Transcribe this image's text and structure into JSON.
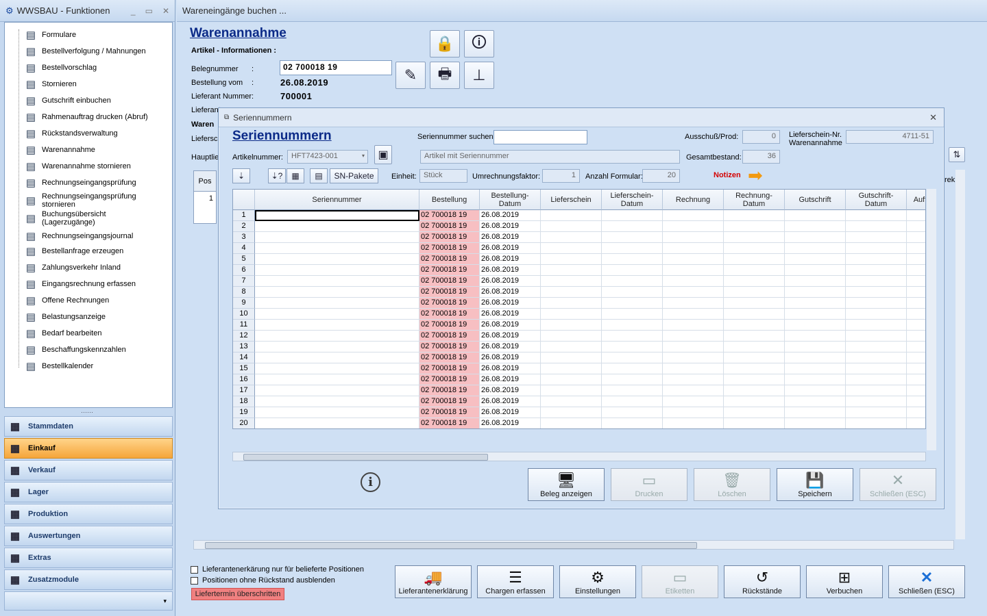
{
  "left_panel": {
    "title": "WWSBAU - Funktionen",
    "tree": [
      {
        "label": "Formulare",
        "icon": "document-icon"
      },
      {
        "label": "Bestellverfolgung / Mahnungen",
        "icon": "map-icon"
      },
      {
        "label": "Bestellvorschlag",
        "icon": "cart-icon"
      },
      {
        "label": "Stornieren",
        "icon": "cart-cancel-icon"
      },
      {
        "label": "Gutschrift einbuchen",
        "icon": "calculator-icon"
      },
      {
        "label": "Rahmenauftrag drucken (Abruf)",
        "icon": "print-document-icon"
      },
      {
        "label": "Rückstandsverwaltung",
        "icon": "clock-icon"
      },
      {
        "label": "Warenannahme",
        "icon": "receive-icon"
      },
      {
        "label": "Warenannahme stornieren",
        "icon": "receive-cancel-icon"
      },
      {
        "label": "Rechnungseingangsprüfung",
        "icon": "invoice-check-icon"
      },
      {
        "label": "Rechnungseingangsprüfung\nstornieren",
        "icon": "invoice-cancel-icon"
      },
      {
        "label": "Buchungsübersicht\n(Lagerzugänge)",
        "icon": "list-icon"
      },
      {
        "label": "Rechnungseingangsjournal",
        "icon": "chart-icon"
      },
      {
        "label": "Bestellanfrage erzeugen",
        "icon": "request-icon"
      },
      {
        "label": "Zahlungsverkehr Inland",
        "icon": "money-icon"
      },
      {
        "label": "Eingangsrechnung erfassen",
        "icon": "euro-icon"
      },
      {
        "label": "Offene Rechnungen",
        "icon": "euro-open-icon"
      },
      {
        "label": "Belastungsanzeige",
        "icon": "weight-icon"
      },
      {
        "label": "Bedarf bearbeiten",
        "icon": "keyboard-icon"
      },
      {
        "label": "Beschaffungskennzahlen",
        "icon": "table-icon"
      },
      {
        "label": "Bestellkalender",
        "icon": "calendar-icon"
      }
    ],
    "nav": [
      {
        "label": "Stammdaten",
        "icon": "database-icon",
        "active": false
      },
      {
        "label": "Einkauf",
        "icon": "cart-icon",
        "active": true
      },
      {
        "label": "Verkauf",
        "icon": "register-icon",
        "active": false
      },
      {
        "label": "Lager",
        "icon": "warehouse-icon",
        "active": false
      },
      {
        "label": "Produktion",
        "icon": "factory-icon",
        "active": false
      },
      {
        "label": "Auswertungen",
        "icon": "analytics-icon",
        "active": false
      },
      {
        "label": "Extras",
        "icon": "puzzle-icon",
        "active": false
      },
      {
        "label": "Zusatzmodule",
        "icon": "modules-icon",
        "active": false
      }
    ]
  },
  "main": {
    "title": "Wareneingänge buchen ...",
    "heading": "Warenannahme",
    "subheading": "Artikel - Informationen :",
    "belegnummer_label": "Belegnummer",
    "belegnummer_value": "02 700018 19",
    "bestellung_vom_label": "Bestellung vom",
    "bestellung_vom_value": "26.08.2019",
    "lieferant_label": "Lieferant Nummer",
    "lieferant_value": "700001",
    "lieferant2_label": "Lieferant",
    "colon": ":",
    "ware_label": "Waren",
    "liefersch_label": "Liefersch",
    "haupt_label": "Hauptlie",
    "pos_header": "Pos",
    "pos_value": "1",
    "rek_label": "rek",
    "check1": "Lieferantenerkärung nur für belieferte Positionen",
    "check2": "Positionen ohne Rückstand ausblenden",
    "overdue_badge": "Liefertermin überschritten",
    "bottom_buttons": [
      {
        "label": "Lieferantenerklärung",
        "icon": "truck-icon",
        "disabled": false
      },
      {
        "label": "Chargen erfassen",
        "icon": "charges-icon",
        "disabled": false
      },
      {
        "label": "Einstellungen",
        "icon": "gear-icon",
        "disabled": false
      },
      {
        "label": "Etiketten",
        "icon": "label-icon",
        "disabled": true
      },
      {
        "label": "Rückstände",
        "icon": "history-icon",
        "disabled": false
      },
      {
        "label": "Verbuchen",
        "icon": "add-box-icon",
        "disabled": false
      },
      {
        "label": "Schließen (ESC)",
        "icon": "close-icon",
        "disabled": false
      }
    ]
  },
  "dialog": {
    "title": "Seriennummern",
    "heading": "Seriennummern",
    "search_label": "Seriennummer suchen:",
    "search_value": "",
    "artikel_label": "Artikelnummer:",
    "artikel_value": "HFT7423-001",
    "artikel_desc": "Artikel mit Seriennummer",
    "ausschuss_label": "Ausschuß/Prod:",
    "ausschuss_value": "0",
    "gesamt_label": "Gesamtbestand:",
    "gesamt_value": "36",
    "lieferschein_label": "Lieferschein-Nr.\nWarenannahme",
    "lieferschein_value": "4711-51",
    "sn_pakete": "SN-Pakete",
    "einheit_label": "Einheit:",
    "einheit_value": "Stück",
    "umrechnung_label": "Umrechnungsfaktor:",
    "umrechnung_value": "1",
    "anzahl_label": "Anzahl Formular:",
    "anzahl_value": "20",
    "notizen": "Notizen",
    "columns": [
      "Seriennummer",
      "Bestellung",
      "Bestellung-\nDatum",
      "Lieferschein",
      "Lieferschein-\nDatum",
      "Rechnung",
      "Rechnung-\nDatum",
      "Gutschrift",
      "Gutschrift-\nDatum",
      "Auft"
    ],
    "rows": [
      {
        "nr": "1",
        "bestellung": "02 700018 19",
        "datum": "26.08.2019"
      },
      {
        "nr": "2",
        "bestellung": "02 700018 19",
        "datum": "26.08.2019"
      },
      {
        "nr": "3",
        "bestellung": "02 700018 19",
        "datum": "26.08.2019"
      },
      {
        "nr": "4",
        "bestellung": "02 700018 19",
        "datum": "26.08.2019"
      },
      {
        "nr": "5",
        "bestellung": "02 700018 19",
        "datum": "26.08.2019"
      },
      {
        "nr": "6",
        "bestellung": "02 700018 19",
        "datum": "26.08.2019"
      },
      {
        "nr": "7",
        "bestellung": "02 700018 19",
        "datum": "26.08.2019"
      },
      {
        "nr": "8",
        "bestellung": "02 700018 19",
        "datum": "26.08.2019"
      },
      {
        "nr": "9",
        "bestellung": "02 700018 19",
        "datum": "26.08.2019"
      },
      {
        "nr": "10",
        "bestellung": "02 700018 19",
        "datum": "26.08.2019"
      },
      {
        "nr": "11",
        "bestellung": "02 700018 19",
        "datum": "26.08.2019"
      },
      {
        "nr": "12",
        "bestellung": "02 700018 19",
        "datum": "26.08.2019"
      },
      {
        "nr": "13",
        "bestellung": "02 700018 19",
        "datum": "26.08.2019"
      },
      {
        "nr": "14",
        "bestellung": "02 700018 19",
        "datum": "26.08.2019"
      },
      {
        "nr": "15",
        "bestellung": "02 700018 19",
        "datum": "26.08.2019"
      },
      {
        "nr": "16",
        "bestellung": "02 700018 19",
        "datum": "26.08.2019"
      },
      {
        "nr": "17",
        "bestellung": "02 700018 19",
        "datum": "26.08.2019"
      },
      {
        "nr": "18",
        "bestellung": "02 700018 19",
        "datum": "26.08.2019"
      },
      {
        "nr": "19",
        "bestellung": "02 700018 19",
        "datum": "26.08.2019"
      },
      {
        "nr": "20",
        "bestellung": "02 700018 19",
        "datum": "26.08.2019"
      }
    ],
    "buttons": [
      {
        "label": "Beleg anzeigen",
        "icon": "monitor-icon",
        "disabled": false
      },
      {
        "label": "Drucken",
        "icon": "print-icon",
        "disabled": true
      },
      {
        "label": "Löschen",
        "icon": "trash-icon",
        "disabled": true
      },
      {
        "label": "Speichern",
        "icon": "save-icon",
        "disabled": false
      },
      {
        "label": "Schließen (ESC)",
        "icon": "close-icon",
        "disabled": true
      }
    ]
  },
  "colors": {
    "accent": "#0b2a88",
    "active_nav": "#f5a53a",
    "pink_cell": "#f7bfc2",
    "notizen": "#d40000"
  }
}
